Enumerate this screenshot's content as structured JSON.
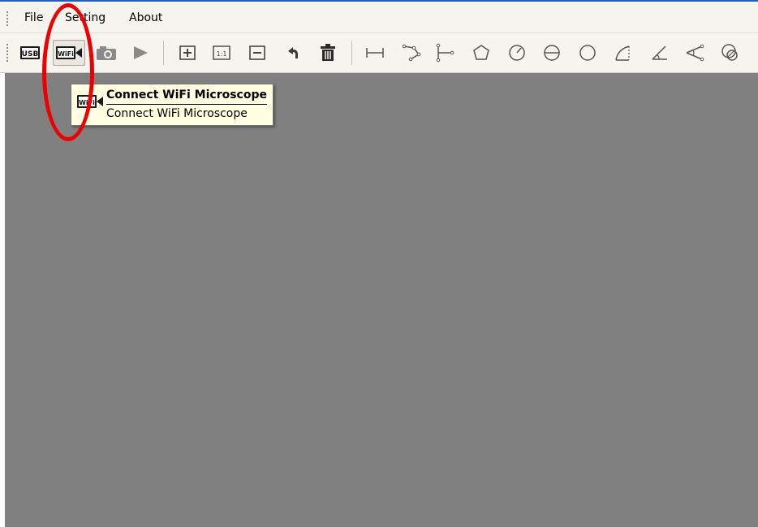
{
  "menu": {
    "items": [
      {
        "label": "File"
      },
      {
        "label": "Setting"
      },
      {
        "label": "About"
      }
    ]
  },
  "toolbar": {
    "usb_label": "USB",
    "wifi_label": "WiFi",
    "zoom_reset_label": "1:1",
    "pressed_button": "connect-wifi-button"
  },
  "tooltip": {
    "title": "Connect WiFi Microscope",
    "description": "Connect WiFi Microscope"
  },
  "colors": {
    "workspace": "#808080",
    "tooltip_bg": "#ffffe1",
    "highlight": "#ee0000",
    "accent_line": "#1c5fc8"
  }
}
